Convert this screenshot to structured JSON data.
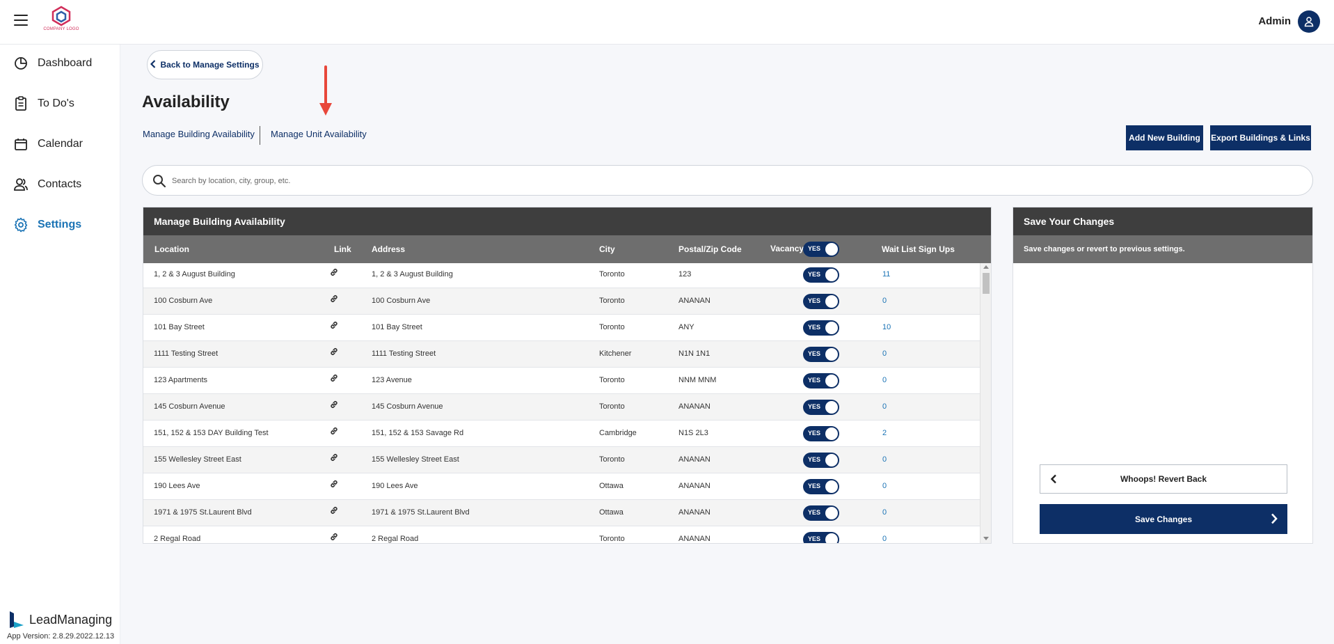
{
  "header": {
    "logo_text": "COMPANY LOGO",
    "user_name": "Admin",
    "accent_color": "#0d2f66"
  },
  "sidebar": {
    "items": [
      {
        "label": "Dashboard",
        "icon": "pie-chart-icon"
      },
      {
        "label": "To Do's",
        "icon": "clipboard-icon"
      },
      {
        "label": "Calendar",
        "icon": "calendar-icon"
      },
      {
        "label": "Contacts",
        "icon": "contacts-icon"
      },
      {
        "label": "Settings",
        "icon": "gear-icon",
        "active": true
      }
    ],
    "brand_name": "LeadManaging",
    "app_version": "App Version: 2.8.29.2022.12.13"
  },
  "main": {
    "back_label": "Back to Manage Settings",
    "title": "Availability",
    "tabs": [
      {
        "label": "Manage Building Availability"
      },
      {
        "label": "Manage Unit Availability"
      }
    ],
    "add_building_label": "Add New Building",
    "export_label": "Export Buildings & Links",
    "search_placeholder": "Search by location, city, group, etc."
  },
  "table": {
    "title": "Manage Building Availability",
    "columns": {
      "location": "Location",
      "link": "Link",
      "address": "Address",
      "city": "City",
      "postal": "Postal/Zip Code",
      "vacancy": "Vacancy",
      "waitlist": "Wait List Sign Ups"
    },
    "vacancy_all_label": "YES",
    "rows": [
      {
        "location": "1, 2 & 3 August Building",
        "address": "1, 2 & 3 August Building",
        "city": "Toronto",
        "postal": "123",
        "vacancy": "YES",
        "waitlist": "11"
      },
      {
        "location": "100 Cosburn Ave",
        "address": "100 Cosburn Ave",
        "city": "Toronto",
        "postal": "ANANAN",
        "vacancy": "YES",
        "waitlist": "0"
      },
      {
        "location": "101 Bay Street",
        "address": "101 Bay Street",
        "city": "Toronto",
        "postal": "ANY",
        "vacancy": "YES",
        "waitlist": "10"
      },
      {
        "location": "1111 Testing Street",
        "address": "1111 Testing Street",
        "city": "Kitchener",
        "postal": "N1N 1N1",
        "vacancy": "YES",
        "waitlist": "0"
      },
      {
        "location": "123 Apartments",
        "address": "123 Avenue",
        "city": "Toronto",
        "postal": "NNM MNM",
        "vacancy": "YES",
        "waitlist": "0"
      },
      {
        "location": "145 Cosburn Avenue",
        "address": "145 Cosburn Avenue",
        "city": "Toronto",
        "postal": "ANANAN",
        "vacancy": "YES",
        "waitlist": "0"
      },
      {
        "location": "151, 152 & 153 DAY Building Test",
        "address": "151, 152 & 153 Savage Rd",
        "city": "Cambridge",
        "postal": "N1S 2L3",
        "vacancy": "YES",
        "waitlist": "2"
      },
      {
        "location": "155 Wellesley Street East",
        "address": "155 Wellesley Street East",
        "city": "Toronto",
        "postal": "ANANAN",
        "vacancy": "YES",
        "waitlist": "0"
      },
      {
        "location": "190 Lees Ave",
        "address": "190 Lees Ave",
        "city": "Ottawa",
        "postal": "ANANAN",
        "vacancy": "YES",
        "waitlist": "0"
      },
      {
        "location": "1971 & 1975 St.Laurent Blvd",
        "address": "1971 & 1975 St.Laurent Blvd",
        "city": "Ottawa",
        "postal": "ANANAN",
        "vacancy": "YES",
        "waitlist": "0"
      },
      {
        "location": "2 Regal Road",
        "address": "2 Regal Road",
        "city": "Toronto",
        "postal": "ANANAN",
        "vacancy": "YES",
        "waitlist": "0"
      }
    ]
  },
  "save_panel": {
    "title": "Save Your Changes",
    "subtitle": "Save changes or revert to previous settings.",
    "revert_label": "Whoops! Revert Back",
    "save_label": "Save Changes"
  }
}
